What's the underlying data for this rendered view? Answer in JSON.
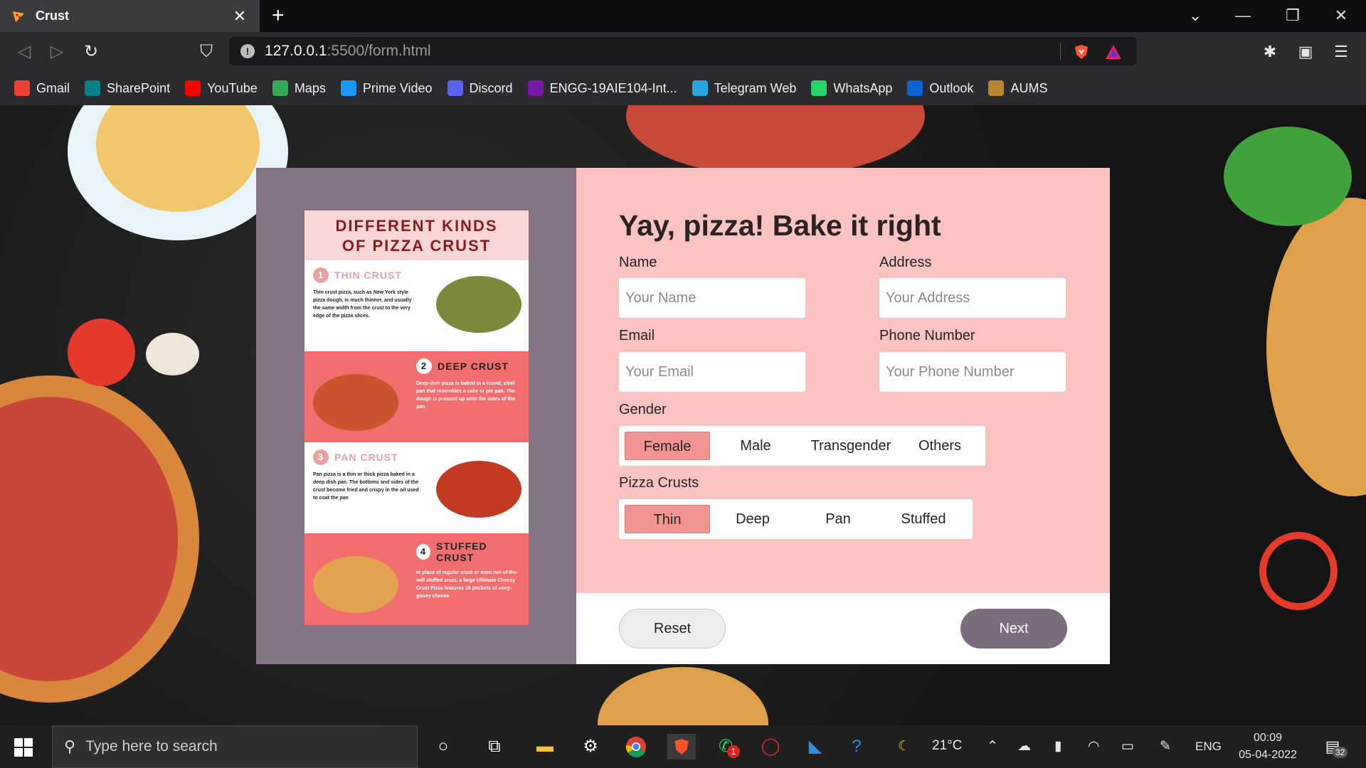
{
  "browser": {
    "tab_title": "Crust",
    "url_host": "127.0.0.1",
    "url_path": ":5500/form.html",
    "bookmarks": [
      {
        "label": "Gmail",
        "icon": "gmail-icon",
        "color": "#ea4335"
      },
      {
        "label": "SharePoint",
        "icon": "sharepoint-icon",
        "color": "#038387"
      },
      {
        "label": "YouTube",
        "icon": "youtube-icon",
        "color": "#ff0000"
      },
      {
        "label": "Maps",
        "icon": "maps-icon",
        "color": "#34a853"
      },
      {
        "label": "Prime Video",
        "icon": "prime-video-icon",
        "color": "#1a98ff"
      },
      {
        "label": "Discord",
        "icon": "discord-icon",
        "color": "#5865f2"
      },
      {
        "label": "ENGG-19AIE104-Int...",
        "icon": "onenote-icon",
        "color": "#7719aa"
      },
      {
        "label": "Telegram Web",
        "icon": "telegram-icon",
        "color": "#2aa3df"
      },
      {
        "label": "WhatsApp",
        "icon": "whatsapp-icon",
        "color": "#25d366"
      },
      {
        "label": "Outlook",
        "icon": "outlook-icon",
        "color": "#0a64d4"
      },
      {
        "label": "AUMS",
        "icon": "aums-icon",
        "color": "#b8862e"
      }
    ]
  },
  "infographic": {
    "title_line1": "DIFFERENT KINDS",
    "title_line2": "OF PIZZA CRUST",
    "sections": [
      {
        "num": "1",
        "heading": "THIN CRUST",
        "text": "Thin crust pizza, such as New York style pizza dough, is much thinner, and usually the same width from the crust to the very edge of the pizza slices."
      },
      {
        "num": "2",
        "heading": "DEEP CRUST",
        "text": "Deep-dish pizza is baked in a round, steel pan that resembles a cake or pie pan. The dough is pressed up onto the sides of the pan."
      },
      {
        "num": "3",
        "heading": "PAN CRUST",
        "text": "Pan pizza is a thin or thick pizza baked in a deep dish pan. The bottoms and sides of the crust become fried and crispy in the oil used to coat the pan"
      },
      {
        "num": "4",
        "heading": "STUFFED CRUST",
        "text": "In place of regular crust or even run-of-the-mill stuffed crust, a large Ultimate Cheesy Crust Pizza features 16 pockets of ooey-gooey cheese."
      }
    ]
  },
  "form": {
    "title": "Yay, pizza! Bake it right",
    "name_label": "Name",
    "name_placeholder": "Your Name",
    "address_label": "Address",
    "address_placeholder": "Your Address",
    "email_label": "Email",
    "email_placeholder": "Your Email",
    "phone_label": "Phone Number",
    "phone_placeholder": "Your Phone Number",
    "gender_label": "Gender",
    "gender_options": [
      "Female",
      "Male",
      "Transgender",
      "Others"
    ],
    "gender_selected": "Female",
    "crust_label": "Pizza Crusts",
    "crust_options": [
      "Thin",
      "Deep",
      "Pan",
      "Stuffed"
    ],
    "crust_selected": "Thin",
    "reset_label": "Reset",
    "next_label": "Next"
  },
  "taskbar": {
    "search_placeholder": "Type here to search",
    "weather": "21°C",
    "language": "ENG",
    "time": "00:09",
    "date": "05-04-2022",
    "notification_count": "32",
    "whatsapp_badge": "1"
  },
  "colors": {
    "card_left": "#827385",
    "card_right": "#f8c3c1",
    "selected_option": "#f29491",
    "next_button": "#7d6b7f"
  }
}
